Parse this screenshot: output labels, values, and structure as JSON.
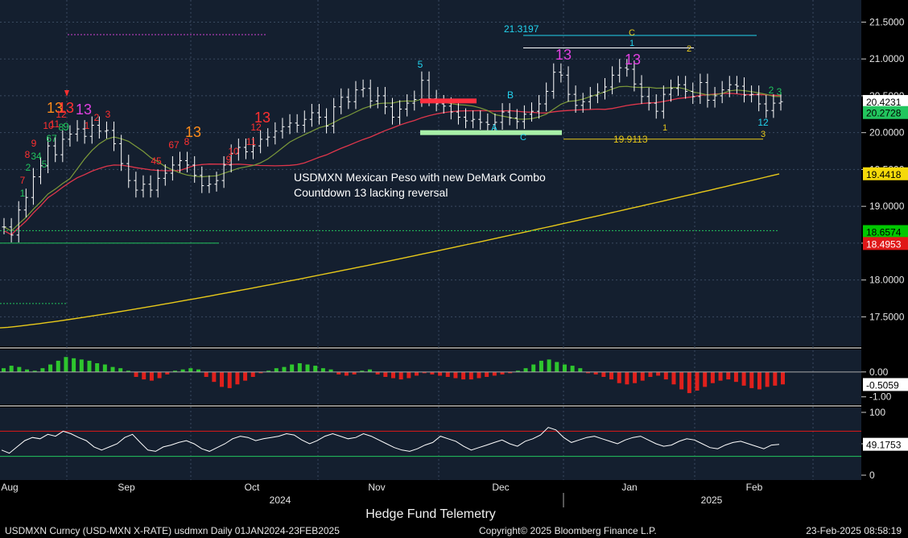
{
  "chart_data": {
    "type": "line",
    "annotation": [
      "USDMXN Mexican Peso with new DeMark Combo",
      "Countdown 13 lacking reversal"
    ],
    "x_months": [
      "Aug",
      "Sep",
      "Oct",
      "Nov",
      "Dec",
      "Jan",
      "Feb"
    ],
    "x_years": [
      "2024",
      "2025"
    ],
    "price_panel": {
      "y_ticks": [
        "21.5000",
        "21.0000",
        "20.5000",
        "20.0000",
        "19.5000",
        "19.0000",
        "18.5000",
        "18.0000",
        "17.5000"
      ],
      "ylim": [
        17.1,
        21.8
      ],
      "price_close": [
        18.72,
        18.61,
        18.95,
        19.12,
        19.4,
        19.55,
        19.82,
        19.7,
        19.91,
        19.98,
        20.05,
        19.95,
        20.1,
        20.02,
        20.03,
        19.85,
        19.58,
        19.35,
        19.22,
        19.3,
        19.22,
        19.38,
        19.45,
        19.56,
        19.62,
        19.56,
        19.42,
        19.28,
        19.3,
        19.35,
        19.56,
        19.72,
        19.8,
        19.74,
        19.82,
        19.91,
        19.94,
        20.02,
        20.08,
        20.13,
        20.1,
        20.18,
        20.27,
        20.21,
        20.09,
        20.35,
        20.48,
        20.42,
        20.58,
        20.6,
        20.43,
        20.5,
        20.35,
        20.21,
        20.32,
        20.4,
        20.45,
        20.71,
        20.46,
        20.39,
        20.36,
        20.28,
        20.21,
        20.16,
        20.18,
        20.14,
        20.11,
        20.14,
        20.28,
        20.2,
        20.15,
        20.25,
        20.29,
        20.39,
        20.56,
        20.82,
        20.78,
        20.52,
        20.37,
        20.42,
        20.5,
        20.55,
        20.62,
        20.78,
        20.88,
        20.86,
        20.66,
        20.49,
        20.4,
        20.29,
        20.52,
        20.6,
        20.65,
        20.56,
        20.49,
        20.68,
        20.44,
        20.5,
        20.58,
        20.65,
        20.63,
        20.51,
        20.52,
        20.39,
        20.3,
        20.4,
        20.42
      ],
      "price_labels": [
        {
          "text": "20.4231",
          "value": 20.4231,
          "bg": "#ffffff",
          "fg": "#000000"
        },
        {
          "text": "20.2728",
          "value": 20.2728,
          "bg": "#22c55e",
          "fg": "#000000"
        },
        {
          "text": "19.4418",
          "value": 19.4418,
          "bg": "#f5d90a",
          "fg": "#000000"
        },
        {
          "text": "18.6574",
          "value": 18.6574,
          "bg": "#00c800",
          "fg": "#000000"
        },
        {
          "text": "18.4953",
          "value": 18.4953,
          "bg": "#e01818",
          "fg": "#ffffff"
        }
      ],
      "level_labels": [
        "21.3197",
        "19.9113"
      ],
      "demark_markers": [
        "1",
        "2",
        "34",
        "5",
        "67",
        "8",
        "9",
        "13",
        "7",
        "8",
        "9",
        "10",
        "11",
        "12",
        "13",
        "13",
        "2",
        "3",
        "1",
        "45",
        "67",
        "8",
        "13",
        "9",
        "10",
        "11",
        "12",
        "13",
        "5",
        "B",
        "A",
        "C",
        "13",
        "C",
        "1",
        "13",
        "2",
        "1",
        "2",
        "3",
        "12",
        "3",
        "2",
        "3"
      ]
    },
    "macd_panel": {
      "y_ticks": [
        "0.00",
        "-1.00"
      ],
      "last_label": "-0.5059",
      "ylim": [
        -1.3,
        0.9
      ],
      "values": [
        0.15,
        0.25,
        0.2,
        0.1,
        0.05,
        0.15,
        0.3,
        0.45,
        0.6,
        0.55,
        0.5,
        0.45,
        0.35,
        0.3,
        0.2,
        0.15,
        0.05,
        -0.2,
        -0.3,
        -0.35,
        -0.25,
        -0.1,
        0.05,
        0.1,
        0.15,
        0.1,
        -0.2,
        -0.4,
        -0.6,
        -0.65,
        -0.5,
        -0.35,
        -0.2,
        -0.05,
        0.05,
        0.15,
        0.2,
        0.3,
        0.35,
        0.3,
        0.25,
        0.15,
        0.1,
        -0.1,
        -0.15,
        -0.1,
        0.05,
        0.1,
        -0.1,
        -0.2,
        -0.25,
        -0.3,
        -0.25,
        -0.15,
        -0.05,
        -0.1,
        -0.15,
        -0.2,
        -0.25,
        -0.3,
        -0.3,
        -0.25,
        -0.2,
        -0.15,
        -0.1,
        -0.05,
        0.05,
        0.15,
        0.3,
        0.45,
        0.5,
        0.4,
        0.3,
        0.25,
        0.15,
        -0.05,
        -0.1,
        -0.2,
        -0.3,
        -0.45,
        -0.5,
        -0.45,
        -0.35,
        -0.2,
        -0.15,
        -0.3,
        -0.5,
        -0.7,
        -0.85,
        -0.75,
        -0.6,
        -0.45,
        -0.35,
        -0.3,
        -0.4,
        -0.55,
        -0.65,
        -0.7,
        -0.6,
        -0.55,
        -0.5
      ]
    },
    "rsi_panel": {
      "y_ticks": [
        "100",
        "50",
        "0"
      ],
      "last_label": "49.1753",
      "ylim": [
        0,
        100
      ],
      "values": [
        40,
        35,
        45,
        55,
        60,
        58,
        65,
        62,
        70,
        66,
        60,
        55,
        45,
        40,
        45,
        50,
        60,
        65,
        52,
        40,
        38,
        45,
        48,
        52,
        55,
        50,
        42,
        38,
        44,
        50,
        58,
        62,
        60,
        55,
        58,
        60,
        62,
        66,
        64,
        56,
        50,
        55,
        62,
        66,
        62,
        58,
        60,
        66,
        62,
        56,
        50,
        44,
        40,
        38,
        42,
        48,
        52,
        62,
        58,
        54,
        46,
        40,
        44,
        48,
        52,
        56,
        50,
        46,
        54,
        58,
        64,
        76,
        72,
        60,
        52,
        56,
        60,
        62,
        58,
        54,
        50,
        56,
        60,
        62,
        56,
        50,
        46,
        48,
        54,
        58,
        56,
        50,
        44,
        42,
        48,
        52,
        54,
        50,
        46,
        42,
        48,
        49
      ]
    }
  },
  "footer": {
    "telemetry": "Hedge Fund Telemetry",
    "left": "USDMXN Curncy (USD-MXN X-RATE) usdmxn  Daily 01JAN2024-23FEB2025",
    "mid": "Copyright© 2025 Bloomberg Finance L.P.",
    "right": "23-Feb-2025 08:58:19"
  }
}
